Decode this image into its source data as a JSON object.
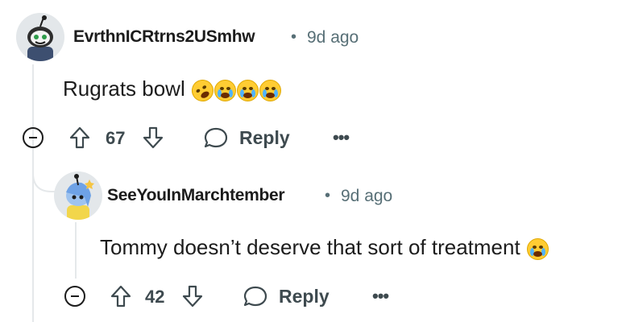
{
  "comments": [
    {
      "username": "EvrthnICRtrns2USmhw",
      "separator": "•",
      "timestamp": "9d ago",
      "body": "Rugrats bowl",
      "votes": "67",
      "reply_label": "Reply",
      "more_label": "•••",
      "avatar_icon": "reddit-snoo-avatar",
      "emojis": [
        "rofl-emoji",
        "crying-emoji",
        "crying-emoji",
        "crying-emoji"
      ]
    },
    {
      "username": "SeeYouInMarchtember",
      "separator": "•",
      "timestamp": "9d ago",
      "body": "Tommy doesn’t deserve that sort of treatment",
      "votes": "42",
      "reply_label": "Reply",
      "more_label": "•••",
      "avatar_icon": "reddit-snoo-avatar",
      "emojis": [
        "crying-emoji"
      ]
    }
  ],
  "colors": {
    "text": "#1c1c1c",
    "meta": "#576f76",
    "action": "#3e4a4f",
    "thread_line": "#e5e8ea",
    "emoji_yellow": "#ffcc33"
  }
}
